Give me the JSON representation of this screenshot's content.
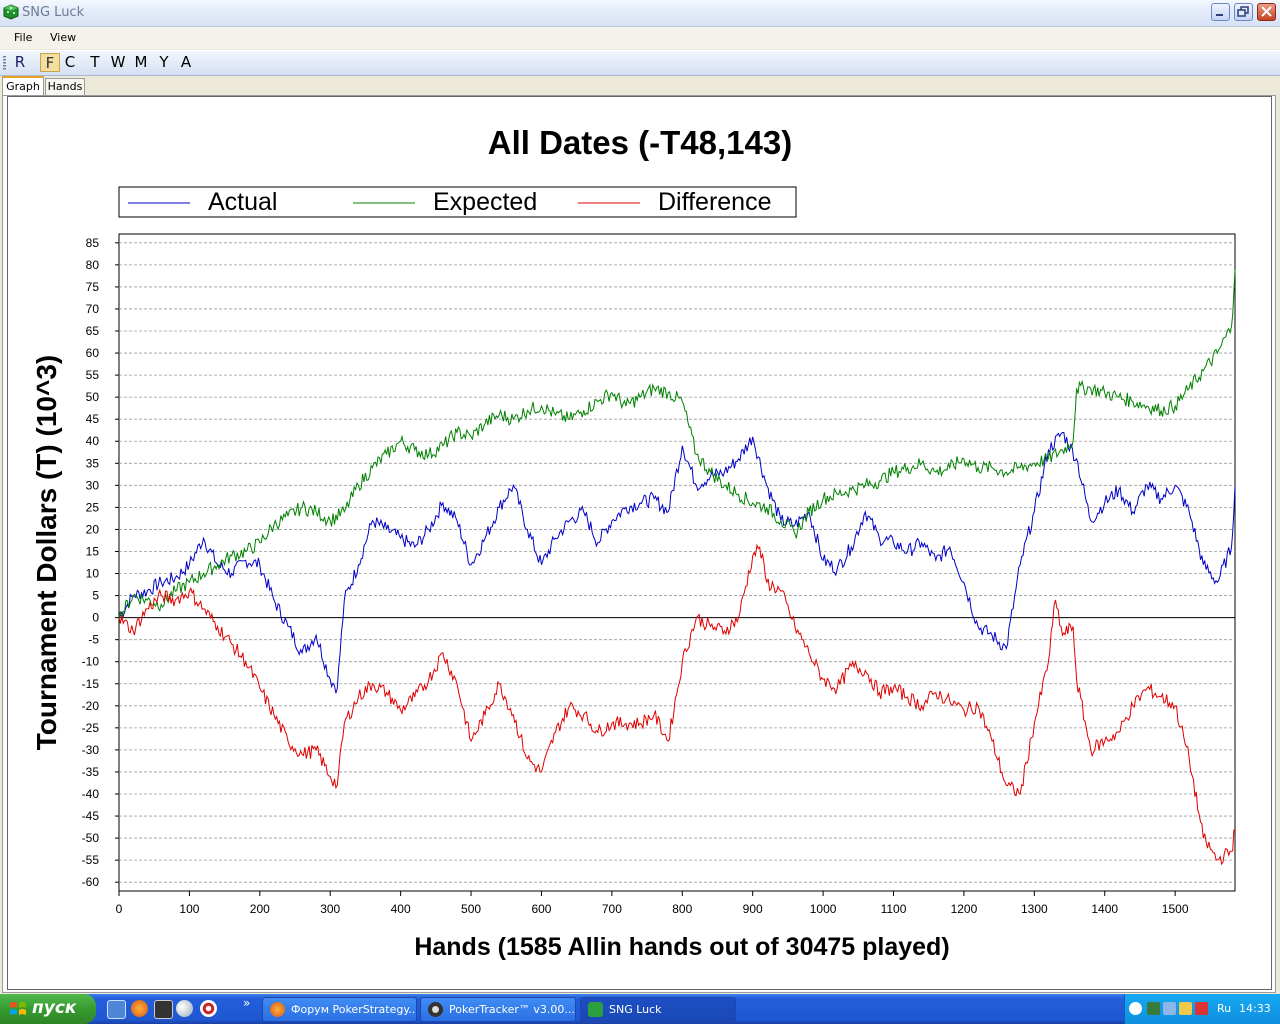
{
  "window": {
    "title": "SNG Luck"
  },
  "menu": {
    "file": "File",
    "view": "View"
  },
  "toolbar": {
    "buttons": [
      "R",
      "F",
      "C",
      "T",
      "W",
      "M",
      "Y",
      "A"
    ]
  },
  "tabs": {
    "graph": "Graph",
    "hands": "Hands"
  },
  "chart_data": {
    "type": "line",
    "title": "All Dates (-T48,143)",
    "xlabel": "Hands (1585 Allin hands out of 30475 played)",
    "ylabel": "Tournament Dollars (T) (10^3)",
    "xlim": [
      0,
      1585
    ],
    "ylim": [
      -62,
      87
    ],
    "xticks": [
      0,
      100,
      200,
      300,
      400,
      500,
      600,
      700,
      800,
      900,
      1000,
      1100,
      1200,
      1300,
      1400,
      1500
    ],
    "yticks": [
      85,
      80,
      75,
      70,
      65,
      60,
      55,
      50,
      45,
      40,
      35,
      30,
      25,
      20,
      15,
      10,
      5,
      0,
      -5,
      -10,
      -15,
      -20,
      -25,
      -30,
      -35,
      -40,
      -45,
      -50,
      -55,
      -60
    ],
    "grid": true,
    "legend_position": "top",
    "series": [
      {
        "name": "Actual",
        "color": "#0000c8",
        "x": [
          0,
          20,
          40,
          60,
          80,
          100,
          120,
          140,
          160,
          180,
          200,
          220,
          240,
          260,
          280,
          300,
          310,
          320,
          340,
          360,
          380,
          400,
          420,
          440,
          460,
          480,
          500,
          520,
          540,
          560,
          580,
          600,
          620,
          640,
          660,
          680,
          700,
          720,
          740,
          760,
          780,
          800,
          820,
          840,
          860,
          880,
          900,
          920,
          940,
          960,
          980,
          1000,
          1020,
          1040,
          1060,
          1080,
          1100,
          1120,
          1140,
          1160,
          1180,
          1200,
          1220,
          1240,
          1260,
          1280,
          1300,
          1320,
          1340,
          1360,
          1380,
          1400,
          1420,
          1440,
          1460,
          1480,
          1500,
          1520,
          1540,
          1560,
          1580,
          1585
        ],
        "y": [
          0,
          5,
          6,
          8,
          9,
          12,
          18,
          12,
          10,
          13,
          12,
          4,
          -2,
          -8,
          -4,
          -14,
          -16,
          4,
          12,
          22,
          20,
          18,
          16,
          20,
          26,
          22,
          12,
          18,
          25,
          30,
          20,
          12,
          18,
          22,
          24,
          17,
          22,
          25,
          26,
          27,
          24,
          39,
          30,
          32,
          33,
          36,
          41,
          30,
          22,
          21,
          24,
          13,
          11,
          16,
          24,
          18,
          17,
          15,
          17,
          13,
          16,
          8,
          -2,
          -4,
          -7,
          12,
          24,
          38,
          42,
          36,
          22,
          26,
          29,
          24,
          30,
          27,
          30,
          24,
          12,
          8,
          16,
          30
        ]
      },
      {
        "name": "Expected",
        "color": "#008000",
        "x": [
          0,
          20,
          40,
          60,
          80,
          100,
          120,
          140,
          160,
          180,
          200,
          220,
          240,
          260,
          280,
          300,
          320,
          340,
          360,
          380,
          400,
          420,
          440,
          460,
          480,
          500,
          520,
          540,
          560,
          580,
          600,
          620,
          640,
          660,
          680,
          700,
          720,
          740,
          760,
          780,
          800,
          820,
          840,
          860,
          880,
          900,
          920,
          940,
          960,
          980,
          1000,
          1020,
          1040,
          1060,
          1080,
          1100,
          1120,
          1140,
          1160,
          1180,
          1200,
          1220,
          1240,
          1260,
          1280,
          1300,
          1320,
          1340,
          1355,
          1360,
          1380,
          1400,
          1420,
          1440,
          1460,
          1480,
          1500,
          1520,
          1540,
          1560,
          1580,
          1585
        ],
        "y": [
          0,
          5,
          4,
          3,
          6,
          8,
          10,
          12,
          14,
          15,
          17,
          21,
          23,
          25,
          24,
          22,
          24,
          30,
          34,
          37,
          40,
          38,
          37,
          39,
          42,
          41,
          44,
          46,
          45,
          47,
          48,
          46,
          45,
          47,
          49,
          51,
          48,
          50,
          52,
          51,
          49,
          37,
          33,
          30,
          28,
          26,
          25,
          22,
          19,
          24,
          27,
          28,
          29,
          30,
          31,
          33,
          34,
          35,
          33,
          34,
          36,
          34,
          34,
          33,
          34,
          35,
          36,
          38,
          40,
          52,
          52,
          51,
          50,
          49,
          48,
          47,
          48,
          52,
          56,
          60,
          66,
          79
        ]
      },
      {
        "name": "Difference",
        "color": "#e00000",
        "x": [
          0,
          20,
          40,
          60,
          80,
          100,
          120,
          140,
          160,
          180,
          200,
          220,
          240,
          260,
          280,
          300,
          310,
          320,
          340,
          360,
          380,
          400,
          420,
          440,
          460,
          480,
          500,
          520,
          540,
          560,
          580,
          600,
          620,
          640,
          660,
          680,
          700,
          720,
          740,
          760,
          780,
          800,
          820,
          840,
          860,
          880,
          900,
          910,
          920,
          940,
          960,
          980,
          1000,
          1020,
          1040,
          1060,
          1080,
          1100,
          1120,
          1140,
          1160,
          1180,
          1200,
          1220,
          1240,
          1260,
          1280,
          1300,
          1320,
          1330,
          1340,
          1355,
          1360,
          1380,
          1400,
          1420,
          1440,
          1460,
          1480,
          1500,
          1520,
          1540,
          1560,
          1580,
          1585
        ],
        "y": [
          0,
          -3,
          2,
          5,
          4,
          6,
          2,
          -2,
          -6,
          -10,
          -16,
          -22,
          -28,
          -31,
          -30,
          -36,
          -38,
          -24,
          -18,
          -15,
          -17,
          -21,
          -18,
          -14,
          -8,
          -15,
          -28,
          -22,
          -15,
          -22,
          -32,
          -35,
          -26,
          -20,
          -22,
          -26,
          -24,
          -24,
          -24,
          -22,
          -28,
          -10,
          0,
          -2,
          -3,
          0,
          14,
          16,
          8,
          6,
          -2,
          -8,
          -14,
          -16,
          -11,
          -12,
          -17,
          -16,
          -18,
          -20,
          -17,
          -19,
          -21,
          -20,
          -28,
          -38,
          -40,
          -24,
          -10,
          4,
          -4,
          -2,
          -14,
          -30,
          -28,
          -26,
          -20,
          -16,
          -18,
          -20,
          -32,
          -50,
          -55,
          -53,
          -48
        ]
      }
    ]
  },
  "taskbar": {
    "start": "пуск",
    "tasks": [
      "Форум PokerStrategy...",
      "PokerTracker™ v3.00...",
      "SNG Luck"
    ],
    "lang": "Ru",
    "clock": "14:33",
    "overflow": "»"
  }
}
